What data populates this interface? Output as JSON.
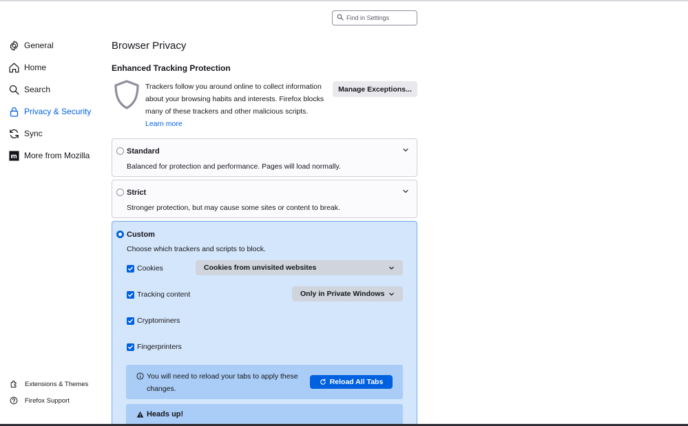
{
  "search": {
    "placeholder": "Find in Settings",
    "icon": "search-icon"
  },
  "sidebar": {
    "items": [
      {
        "label": "General",
        "icon": "gear-icon"
      },
      {
        "label": "Home",
        "icon": "home-icon"
      },
      {
        "label": "Search",
        "icon": "search-icon"
      },
      {
        "label": "Privacy & Security",
        "icon": "lock-icon",
        "selected": true
      },
      {
        "label": "Sync",
        "icon": "sync-icon"
      },
      {
        "label": "More from Mozilla",
        "icon": "mozilla-icon"
      }
    ],
    "footer": [
      {
        "label": "Extensions & Themes",
        "icon": "puzzle-icon"
      },
      {
        "label": "Firefox Support",
        "icon": "help-icon"
      }
    ]
  },
  "main": {
    "page_title": "Browser Privacy",
    "etp": {
      "title": "Enhanced Tracking Protection",
      "description": "Trackers follow you around online to collect information about your browsing habits and interests. Firefox blocks many of these trackers and other malicious scripts.",
      "learn_more": "Learn more",
      "manage_button": "Manage Exceptions..."
    },
    "options": {
      "standard": {
        "title": "Standard",
        "description": "Balanced for protection and performance. Pages will load normally.",
        "selected": false
      },
      "strict": {
        "title": "Strict",
        "description": "Stronger protection, but may cause some sites or content to break.",
        "selected": false
      },
      "custom": {
        "title": "Custom",
        "description": "Choose which trackers and scripts to block.",
        "selected": true,
        "checks": [
          {
            "label": "Cookies",
            "checked": true
          },
          {
            "label": "Tracking content",
            "checked": true
          },
          {
            "label": "Cryptominers",
            "checked": true
          },
          {
            "label": "Fingerprinters",
            "checked": true
          }
        ],
        "cookies_select": "Cookies from unvisited websites",
        "tracking_select": "Only in Private Windows",
        "reload_notice": "You will need to reload your tabs to apply these changes.",
        "reload_button": "Reload All Tabs",
        "heads_up": "Heads up!"
      }
    }
  },
  "colors": {
    "accent": "#0061e0",
    "custom_bg": "#d4e6fb",
    "notice_bg": "#a9cdf6"
  }
}
